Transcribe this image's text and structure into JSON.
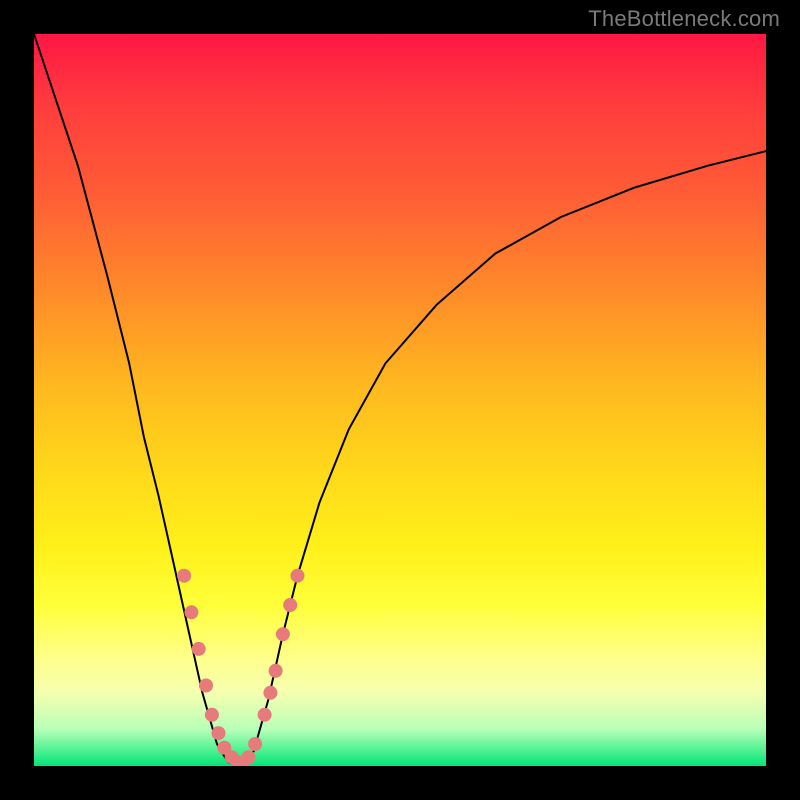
{
  "attribution": "TheBottleneck.com",
  "chart_data": {
    "type": "line",
    "title": "",
    "xlabel": "",
    "ylabel": "",
    "xlim": [
      0,
      100
    ],
    "ylim": [
      0,
      100
    ],
    "series": [
      {
        "name": "left-curve",
        "x": [
          0,
          6,
          10,
          13,
          15,
          17,
          19,
          21,
          23,
          25,
          26.5,
          28
        ],
        "y": [
          100,
          82,
          67,
          55,
          45,
          37,
          28,
          19,
          10,
          3,
          0.5,
          0
        ]
      },
      {
        "name": "right-curve",
        "x": [
          28,
          30,
          32,
          34,
          36,
          39,
          43,
          48,
          55,
          63,
          72,
          82,
          92,
          100
        ],
        "y": [
          0,
          2,
          9,
          18,
          26,
          36,
          46,
          55,
          63,
          70,
          75,
          79,
          82,
          84
        ]
      }
    ],
    "markers": [
      {
        "series": "left-curve",
        "points": [
          {
            "x": 20.5,
            "y": 26
          },
          {
            "x": 21.5,
            "y": 21
          },
          {
            "x": 22.5,
            "y": 16
          },
          {
            "x": 23.5,
            "y": 11
          },
          {
            "x": 24.3,
            "y": 7
          },
          {
            "x": 25.2,
            "y": 4.5
          },
          {
            "x": 26,
            "y": 2.5
          },
          {
            "x": 27,
            "y": 1.2
          },
          {
            "x": 27.8,
            "y": 0.5
          }
        ]
      },
      {
        "series": "right-curve",
        "points": [
          {
            "x": 28.5,
            "y": 0.4
          },
          {
            "x": 29.3,
            "y": 1.2
          },
          {
            "x": 30.2,
            "y": 3
          },
          {
            "x": 31.5,
            "y": 7
          },
          {
            "x": 32.3,
            "y": 10
          },
          {
            "x": 33,
            "y": 13
          },
          {
            "x": 34,
            "y": 18
          },
          {
            "x": 35,
            "y": 22
          },
          {
            "x": 36,
            "y": 26
          }
        ]
      }
    ],
    "marker_color": "#e77a7a",
    "marker_radius_px": 7,
    "background_gradient": {
      "type": "vertical",
      "stops": [
        {
          "pos": 0,
          "color": "#ff1744"
        },
        {
          "pos": 50,
          "color": "#ffd21a"
        },
        {
          "pos": 100,
          "color": "#00e676"
        }
      ]
    }
  }
}
